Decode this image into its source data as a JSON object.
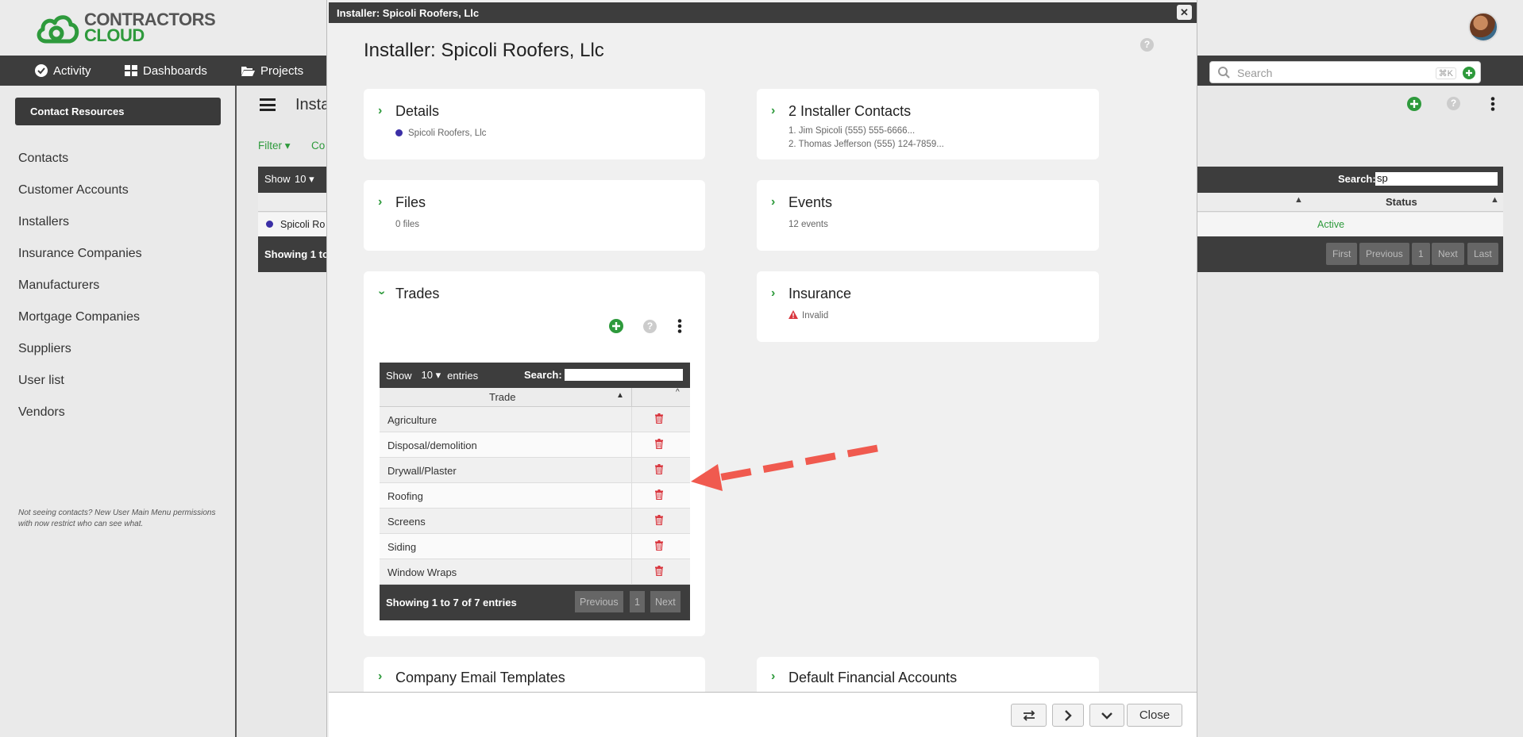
{
  "app": {
    "logo_line1": "CONTRACTORS",
    "logo_line2": "CLOUD",
    "nav": {
      "activity": "Activity",
      "dashboards": "Dashboards",
      "projects": "Projects"
    },
    "search_placeholder": "Search",
    "search_shortcut": "⌘K"
  },
  "sidebar": {
    "button": "Contact Resources",
    "items": [
      "Contacts",
      "Customer Accounts",
      "Installers",
      "Insurance Companies",
      "Manufacturers",
      "Mortgage Companies",
      "Suppliers",
      "User list",
      "Vendors"
    ],
    "note": "Not seeing contacts? New User Main Menu permissions with now restrict who can see what."
  },
  "background_page": {
    "title_partial": "Insta",
    "filter_label": "Filter",
    "col_partial": "Co",
    "show_label": "Show",
    "show_value": "10",
    "search_label": "Search:",
    "search_value": "sp",
    "status_header": "Status",
    "row_name_partial": "Spicoli Ro",
    "row_status": "Active",
    "showing_partial": "Showing 1 to",
    "pager": {
      "first": "First",
      "previous": "Previous",
      "page": "1",
      "next": "Next",
      "last": "Last"
    }
  },
  "modal": {
    "titlebar": "Installer: Spicoli Roofers, Llc",
    "heading": "Installer: Spicoli Roofers, Llc",
    "cards": {
      "details": {
        "title": "Details",
        "sub": "Spicoli Roofers, Llc"
      },
      "contacts": {
        "title": "2 Installer Contacts",
        "lines": [
          "1. Jim Spicoli (555) 555-6666...",
          "2. Thomas Jefferson (555) 124-7859..."
        ]
      },
      "files": {
        "title": "Files",
        "sub": "0 files"
      },
      "events": {
        "title": "Events",
        "sub": "12 events"
      },
      "insurance": {
        "title": "Insurance",
        "sub": "Invalid"
      },
      "trades": {
        "title": "Trades",
        "show_label": "Show",
        "show_value": "10",
        "entries_label": "entries",
        "search_label": "Search:",
        "column": "Trade",
        "rows": [
          "Agriculture",
          "Disposal/demolition",
          "Drywall/Plaster",
          "Roofing",
          "Screens",
          "Siding",
          "Window Wraps"
        ],
        "info": "Showing 1 to 7 of 7 entries",
        "pager": {
          "previous": "Previous",
          "page": "1",
          "next": "Next"
        }
      },
      "email_templates": {
        "title": "Company Email Templates"
      },
      "financial": {
        "title": "Default Financial Accounts"
      }
    },
    "footer": {
      "close": "Close"
    }
  },
  "colors": {
    "accent_green": "#2e9a3c",
    "dark_bar": "#3d3d3d",
    "danger_red": "#d9363e",
    "arrow": "#f05a4f"
  }
}
